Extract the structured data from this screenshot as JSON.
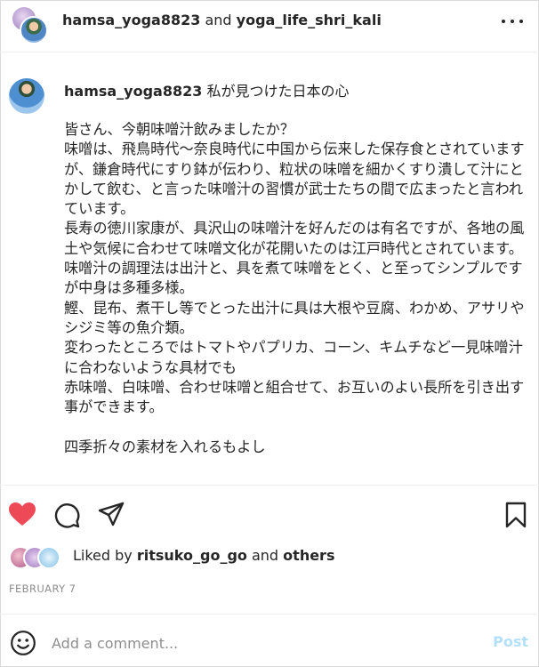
{
  "header": {
    "user1": "hamsa_yoga8823",
    "joiner": " and ",
    "user2": "yoga_life_shri_kali"
  },
  "caption": {
    "username": "hamsa_yoga8823",
    "headline": " 私が見つけた日本の心",
    "body": "皆さん、今朝味噌汁飲みましたか？\n味噌は、飛鳥時代〜奈良時代に中国から伝来した保存食とされていますが、鎌倉時代にすり鉢が伝わり、粒状の味噌を細かくすり潰して汁にとかして飲む、と言った味噌汁の習慣が武士たちの間で広まったと言われています。\n長寿の徳川家康が、具沢山の味噌汁を好んだのは有名ですが、各地の風土や気候に合わせて味噌文化が花開いたのは江戸時代とされています。\n味噌汁の調理法は出汁と、具を煮て味噌をとく、と至ってシンプルですが中身は多種多様。\n鰹、昆布、煮干し等でとった出汁に具は大根や豆腐、わかめ、アサリやシジミ等の魚介類。\n変わったところではトマトやパプリカ、コーン、キムチなど一見味噌汁に合わないような具材でも\n赤味噌、白味噌、合わせ味噌と組合せて、お互いのよい長所を引き出す事ができます。\n\n四季折々の素材を入れるもよし"
  },
  "likes": {
    "prefix": "Liked by ",
    "user": "ritsuko_go_go",
    "joiner": " and ",
    "others": "others"
  },
  "date": "FEBRUARY 7",
  "comment": {
    "placeholder": "Add a comment...",
    "post_label": "Post"
  },
  "colors": {
    "heart": "#ed4956",
    "post_disabled": "#b2dffc",
    "muted": "#8e8e8e"
  },
  "icons": [
    "more-icon",
    "heart-icon",
    "comment-icon",
    "share-icon",
    "bookmark-icon",
    "emoji-icon"
  ]
}
